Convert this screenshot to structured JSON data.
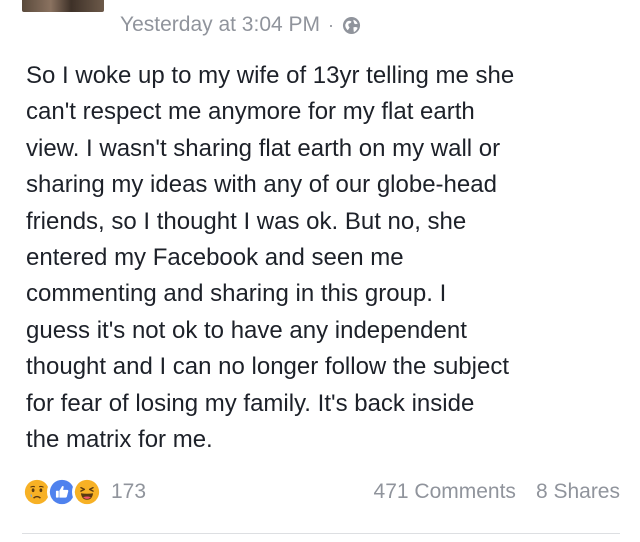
{
  "post": {
    "timestamp": "Yesterday at 3:04 PM",
    "separator": "·",
    "privacy_icon": "globe-icon",
    "text": "So I woke up to my wife of 13yr telling me she\ncan't respect me anymore for my flat earth\nview. I wasn't sharing flat earth on my wall or\nsharing my ideas with any of our globe-head\nfriends, so I thought I was ok. But no, she\nentered my Facebook and seen me\ncommenting and sharing in this group. I\nguess it's not ok to have any independent\nthought and I can no longer follow the subject\nfor fear of losing my family. It's back inside\nthe matrix for me."
  },
  "footer": {
    "reactions": [
      {
        "icon": "sad-reaction-icon",
        "color": "#f7b125"
      },
      {
        "icon": "like-reaction-icon",
        "color": "#4f82ee"
      },
      {
        "icon": "haha-reaction-icon",
        "color": "#f7b125"
      }
    ],
    "reaction_count": "173",
    "comments": "471 Comments",
    "shares": "8 Shares"
  }
}
